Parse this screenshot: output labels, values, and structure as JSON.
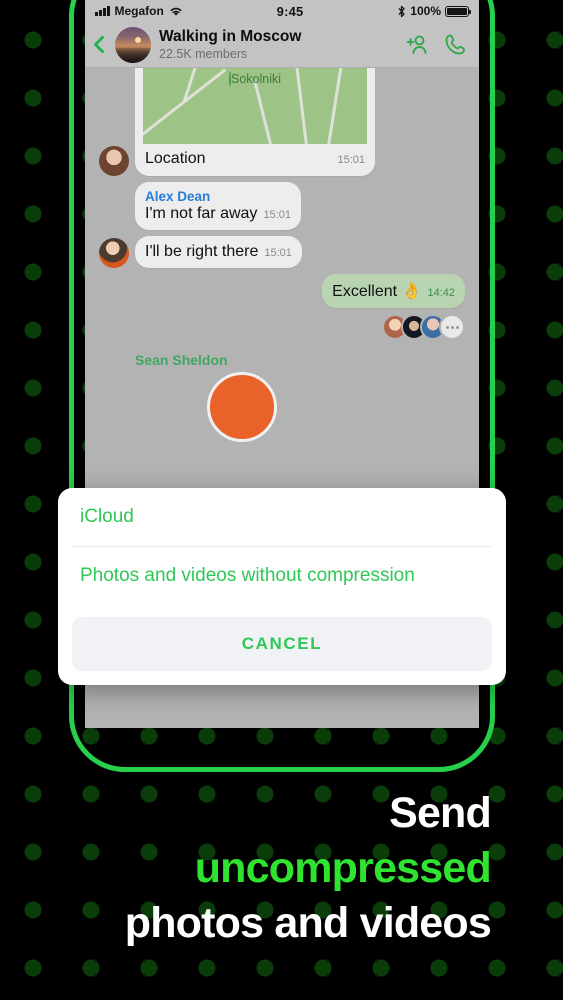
{
  "theme": {
    "accent_green": "#2fe330",
    "frame_green": "#27d04a",
    "dialog_green": "#2fc755",
    "dot_green": "#0b3d0b",
    "background": "#000000",
    "screen_bg": "#b3b3b3"
  },
  "status_bar": {
    "carrier": "Megafon",
    "wifi_icon": "wifi-icon",
    "signal_icon": "cellular-signal-icon",
    "time": "9:45",
    "bluetooth_icon": "bluetooth-icon",
    "battery_percent": "100%",
    "battery_icon": "battery-full-icon"
  },
  "chat_header": {
    "back_icon": "back-chevron-icon",
    "avatar_icon": "group-avatar",
    "title": "Walking in Moscow",
    "subtitle": "22.5K members",
    "add_member_icon": "add-user-icon",
    "call_icon": "phone-call-icon"
  },
  "messages": [
    {
      "type": "location",
      "map_label": "Sokolniki",
      "pin_icon": "map-pin-icon",
      "caption": "Location",
      "time": "15:01",
      "side": "in",
      "avatar": "avatar-woman"
    },
    {
      "type": "text",
      "sender": "Alex Dean",
      "text": "I'm not far away",
      "time": "15:01",
      "side": "in",
      "avatar": ""
    },
    {
      "type": "text",
      "sender": "",
      "text": "I'll be right there",
      "time": "15:01",
      "side": "in",
      "avatar": "avatar-man"
    },
    {
      "type": "text",
      "sender": "",
      "text": "Excellent 👌",
      "time": "14:42",
      "side": "out",
      "avatar": ""
    }
  ],
  "reactions": {
    "more_icon": "more-dots-icon",
    "avatar_count": 3
  },
  "next_sender": {
    "name": "Sean Sheldon"
  },
  "dialog": {
    "option_label": "iCloud",
    "description": "Photos and videos without compression",
    "cancel_label": "CANCEL"
  },
  "headline": {
    "line1": "Send",
    "line2": "uncompressed",
    "line3": "photos and videos"
  }
}
